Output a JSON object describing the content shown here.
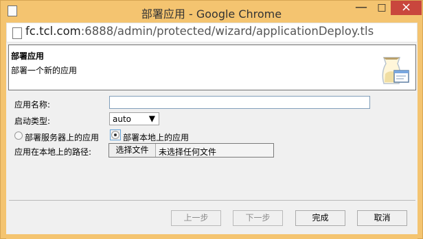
{
  "window": {
    "title": "部署应用 - Google Chrome",
    "minimize_glyph": "—",
    "maximize_glyph": "□",
    "close_glyph": "×",
    "accent_color": "#f4c470",
    "close_color": "#c9463d"
  },
  "addressbar": {
    "host": "fc.tcl.com",
    "rest": ":6888/admin/protected/wizard/applicationDeploy.tls"
  },
  "header": {
    "title": "部署应用",
    "subtitle": "部署一个新的应用",
    "icon": "application-deploy-icon"
  },
  "form": {
    "name_label": "应用名称:",
    "name_value": "",
    "type_label": "启动类型:",
    "type_value": "auto",
    "radio_server_label": "部署服务器上的应用",
    "radio_local_label": "部署本地上的应用",
    "radio_selected": "local",
    "path_label": "应用在本地上的路径:",
    "file_button_label": "选择文件",
    "file_status": "未选择任何文件"
  },
  "buttons": {
    "prev": "上一步",
    "next": "下一步",
    "finish": "完成",
    "cancel": "取消"
  }
}
